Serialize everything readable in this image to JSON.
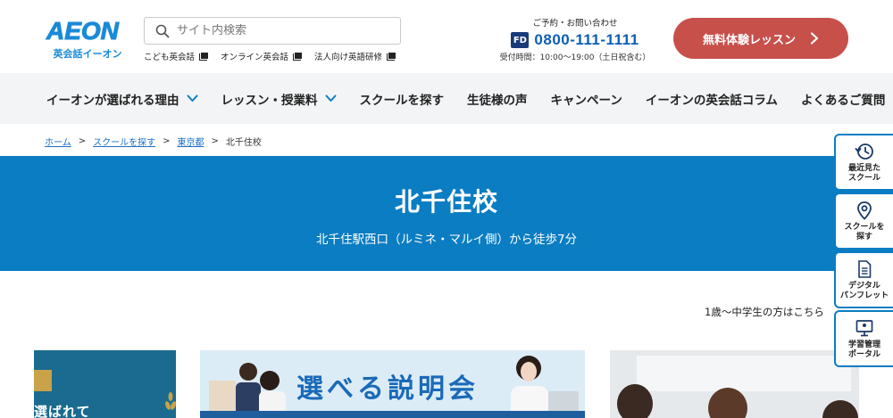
{
  "header": {
    "logo_text": "AEON",
    "logo_sub": "英会話イーオン",
    "search_placeholder": "サイト内検索",
    "sublinks": [
      {
        "label": "こども英会話"
      },
      {
        "label": "オンライン英会話"
      },
      {
        "label": "法人向け英語研修"
      }
    ],
    "contact": {
      "label": "ご予約・お問い合わせ",
      "freedial": "FD",
      "phone": "0800-111-1111",
      "hours": "受付時間：10:00〜19:00（土日祝含む）"
    },
    "cta_label": "無料体験レッスン"
  },
  "nav": {
    "items": [
      {
        "label": "イーオンが選ばれる理由",
        "has_dropdown": true
      },
      {
        "label": "レッスン・授業料",
        "has_dropdown": true
      },
      {
        "label": "スクールを探す",
        "has_dropdown": false
      },
      {
        "label": "生徒様の声",
        "has_dropdown": false
      },
      {
        "label": "キャンペーン",
        "has_dropdown": false
      },
      {
        "label": "イーオンの英会話コラム",
        "has_dropdown": false
      },
      {
        "label": "よくあるご質問",
        "has_dropdown": false
      }
    ]
  },
  "breadcrumb": {
    "items": [
      {
        "label": "ホーム"
      },
      {
        "label": "スクールを探す"
      },
      {
        "label": "東京都"
      }
    ],
    "separator": ">",
    "current": "北千住校"
  },
  "hero": {
    "title": "北千住校",
    "subtitle": "北千住駅西口（ルミネ・マルイ側）から徒歩7分"
  },
  "kids_link": "1歳〜中学生の方はこちら",
  "sidepanel": {
    "items": [
      {
        "label_line1": "最近見た",
        "label_line2": "スクール",
        "icon": "history-icon"
      },
      {
        "label_line1": "スクールを",
        "label_line2": "探す",
        "icon": "map-pin-icon"
      },
      {
        "label_line1": "デジタル",
        "label_line2": "パンフレット",
        "icon": "document-icon"
      },
      {
        "label_line1": "学習管理",
        "label_line2": "ポータル",
        "icon": "monitor-icon"
      }
    ]
  },
  "banners": {
    "left_text": "選ばれて",
    "mid_text": "選べる説明会"
  },
  "colors": {
    "brand_blue": "#0b7dc2",
    "cta_red": "#c7504b",
    "nav_bg": "#f2f4f6",
    "link_blue": "#1a6ec5"
  }
}
